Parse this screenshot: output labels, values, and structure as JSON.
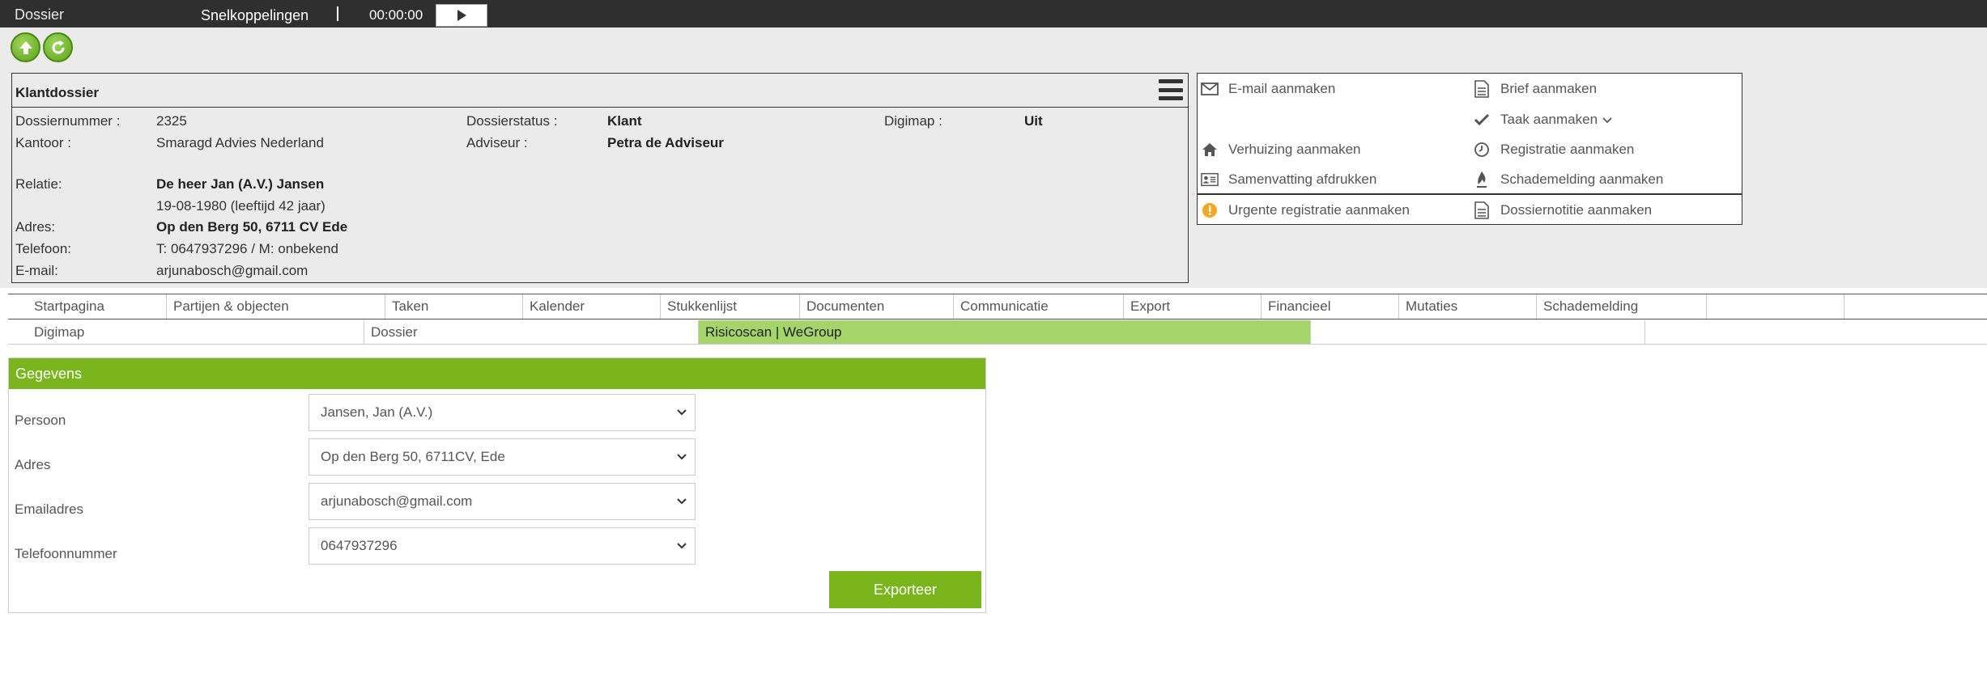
{
  "topbar": {
    "title": "Dossier",
    "shortcuts": "Snelkoppelingen",
    "timer": "00:00:00"
  },
  "dossier": {
    "heading": "Klantdossier",
    "dossiernummer_label": "Dossiernummer :",
    "dossiernummer": "2325",
    "dossierstatus_label": "Dossierstatus :",
    "dossierstatus": "Klant",
    "digimap_label": "Digimap :",
    "digimap": "Uit",
    "kantoor_label": "Kantoor :",
    "kantoor": "Smaragd Advies Nederland",
    "adviseur_label": "Adviseur :",
    "adviseur": "Petra de Adviseur",
    "relatie_label": "Relatie:",
    "relatie": "De heer Jan (A.V.) Jansen",
    "geboortedatum": "19-08-1980 (leeftijd 42 jaar)",
    "adres_label": "Adres:",
    "adres": "Op den Berg 50, 6711 CV Ede",
    "telefoon_label": "Telefoon:",
    "telefoon": "T: 0647937296 / M: onbekend",
    "email_label": "E-mail:",
    "email": "arjunabosch@gmail.com"
  },
  "actions": {
    "email": "E-mail aanmaken",
    "brief": "Brief aanmaken",
    "taak": "Taak aanmaken",
    "verhuizing": "Verhuizing aanmaken",
    "registratie": "Registratie aanmaken",
    "samenvatting": "Samenvatting afdrukken",
    "schademelding": "Schademelding aanmaken",
    "urgente": "Urgente registratie aanmaken",
    "dossiernotitie": "Dossiernotitie aanmaken"
  },
  "tabs_row1": [
    "Startpagina",
    "Partijen & objecten",
    "Taken",
    "Kalender",
    "Stukkenlijst",
    "Documenten",
    "Communicatie",
    "Export",
    "Financieel",
    "Mutaties",
    "Schademelding"
  ],
  "tabs_row2": [
    "Digimap",
    "Dossier",
    "Risicoscan | WeGroup"
  ],
  "form": {
    "heading": "Gegevens",
    "persoon_label": "Persoon",
    "persoon": "Jansen, Jan (A.V.)",
    "adres_label": "Adres",
    "adres": "Op den Berg 50, 6711CV, Ede",
    "email_label": "Emailadres",
    "email": "arjunabosch@gmail.com",
    "telefoon_label": "Telefoonnummer",
    "telefoon": "0647937296",
    "export_button": "Exporteer"
  },
  "colors": {
    "accent_green": "#7ab51d",
    "active_tab": "#a5d46a",
    "topbar": "#2f2f2f",
    "warning": "#f5a623"
  }
}
